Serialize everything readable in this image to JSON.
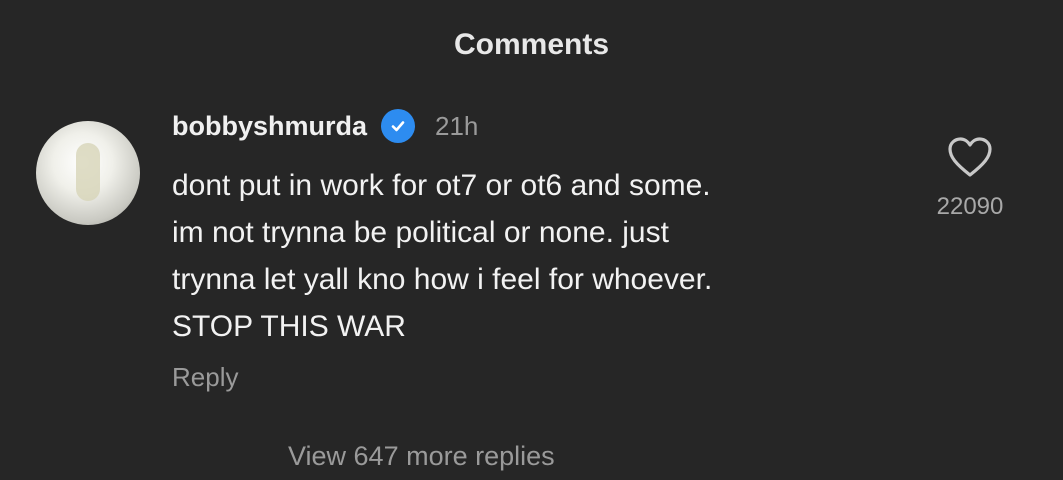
{
  "sheet": {
    "title": "Comments"
  },
  "comment": {
    "username": "bobbyshmurda",
    "verified_icon": "verified-badge-icon",
    "timestamp": "21h",
    "text": "dont put in work for ot7 or ot6 and some.\nim not trynna be political or none. just\ntrynna let yall kno how i feel for whoever.\nSTOP THIS WAR",
    "reply_label": "Reply",
    "like_icon": "heart-icon",
    "like_count": "22090",
    "view_replies_label": "View 647 more replies"
  },
  "colors": {
    "background": "#262626",
    "verified": "#2d8cf0",
    "secondary_text": "#9a9a9a"
  }
}
